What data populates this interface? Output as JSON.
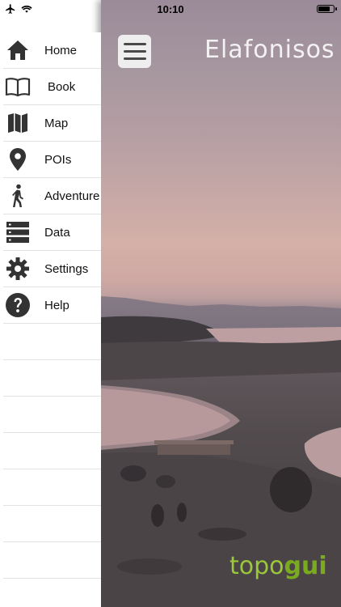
{
  "status_bar": {
    "time": "10:10"
  },
  "main": {
    "title": "Elafonisos",
    "brand_part1": "topo",
    "brand_part2": "gui"
  },
  "menu": {
    "items": [
      {
        "id": "home",
        "label": "Home",
        "icon": "home-icon"
      },
      {
        "id": "book",
        "label": "Book",
        "icon": "book-icon"
      },
      {
        "id": "map",
        "label": "Map",
        "icon": "map-icon"
      },
      {
        "id": "pois",
        "label": "POIs",
        "icon": "location-pin-icon"
      },
      {
        "id": "adventure",
        "label": "Adventure",
        "icon": "hiker-icon"
      },
      {
        "id": "data",
        "label": "Data",
        "icon": "server-icon"
      },
      {
        "id": "settings",
        "label": "Settings",
        "icon": "gear-icon"
      },
      {
        "id": "help",
        "label": "Help",
        "icon": "help-icon"
      }
    ]
  },
  "colors": {
    "icon": "#333333",
    "brand_light": "#9bc83a",
    "brand_dark": "#7aab1e"
  }
}
